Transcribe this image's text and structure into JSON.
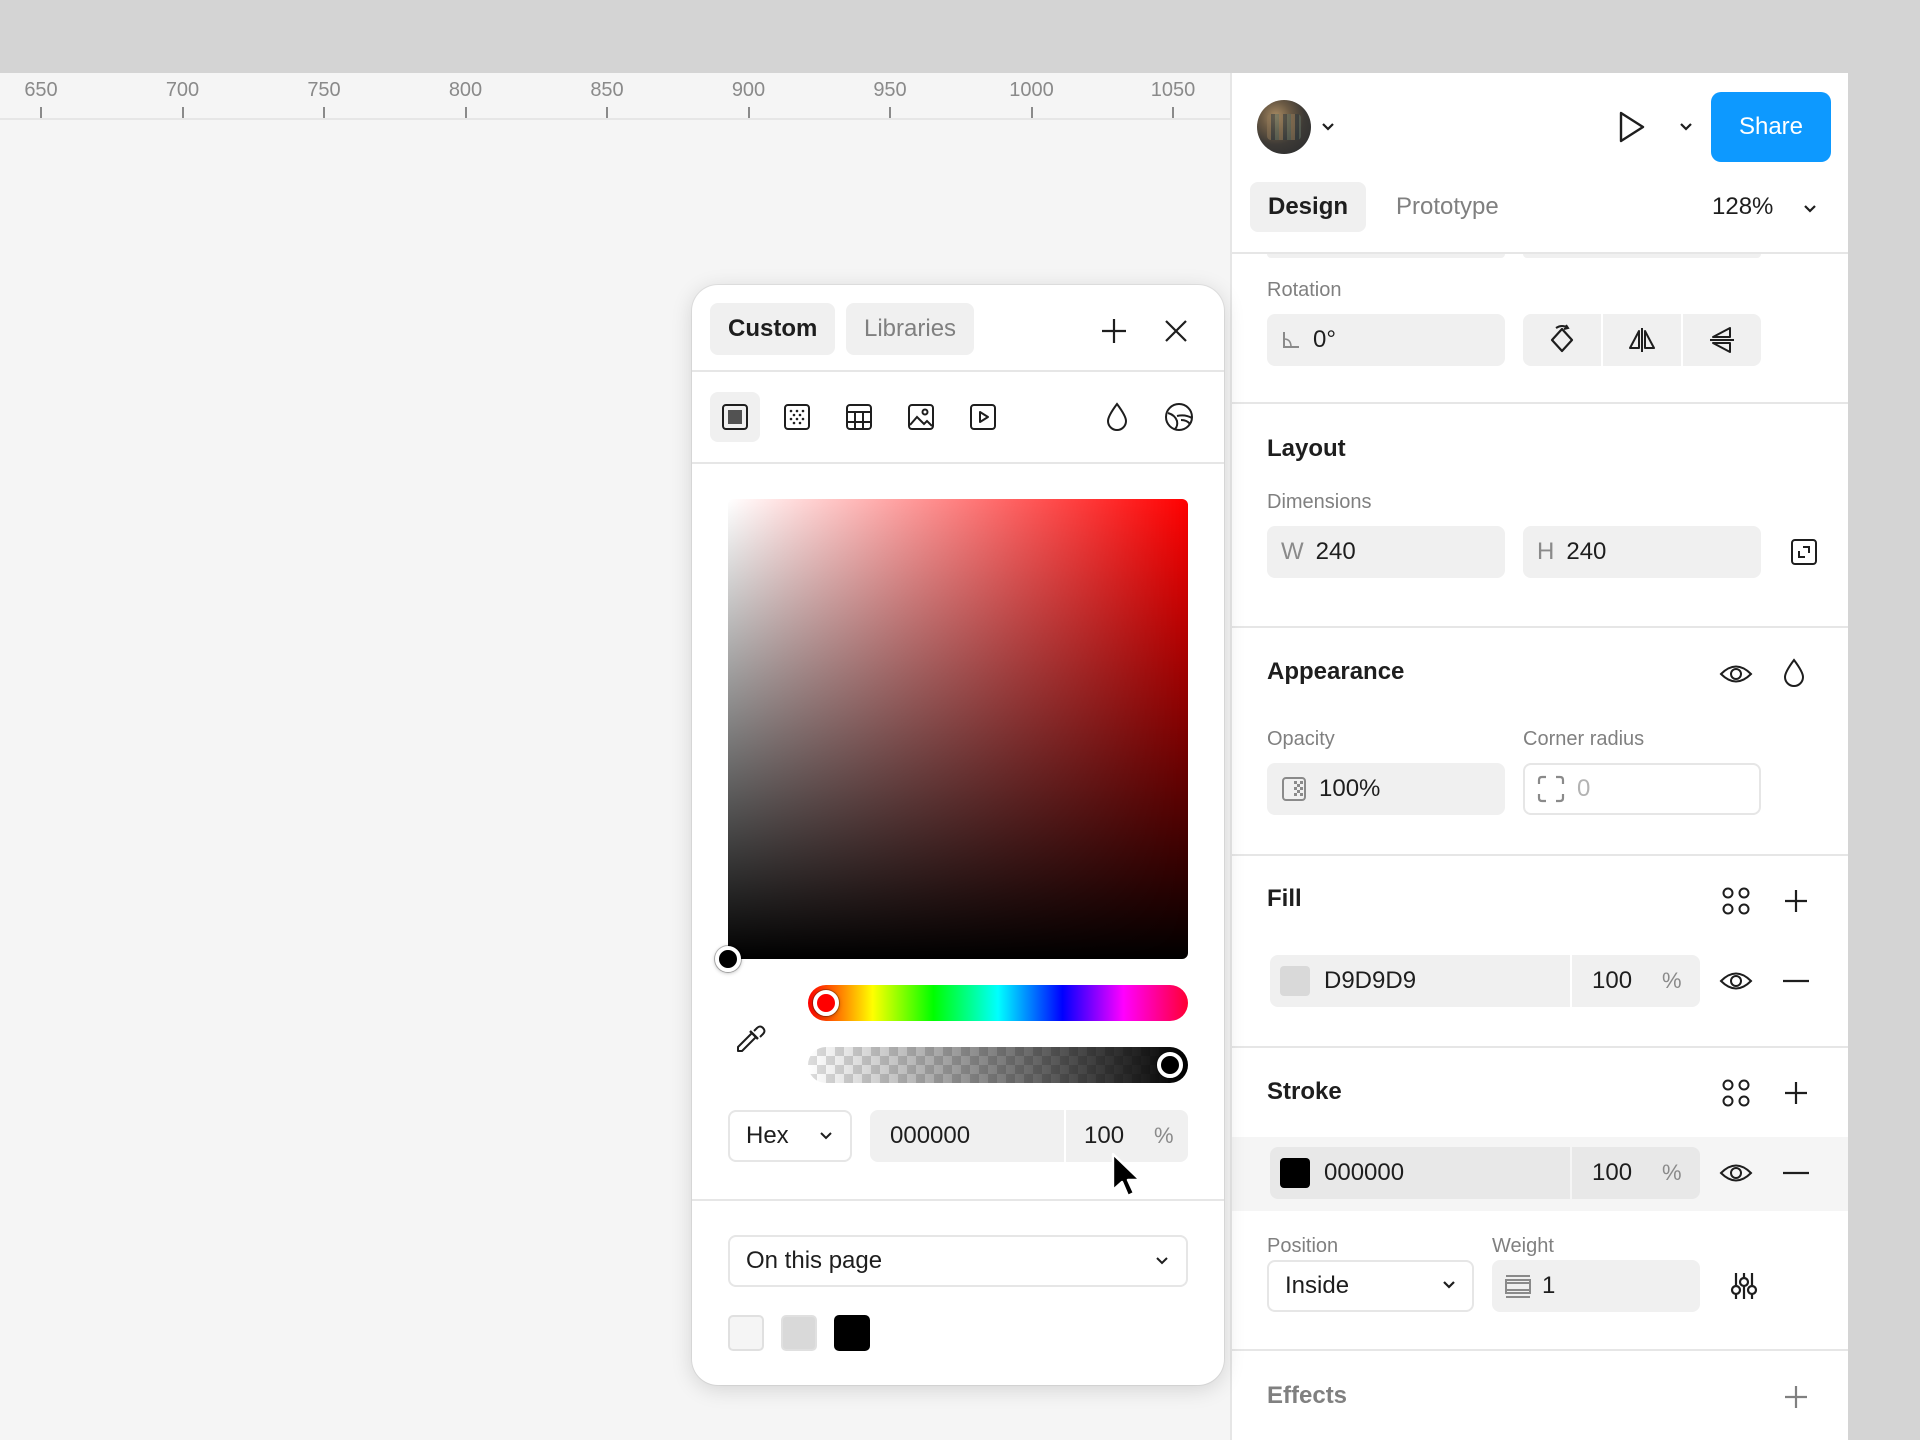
{
  "ruler": {
    "ticks": [
      "650",
      "700",
      "750",
      "800",
      "850",
      "900",
      "950",
      "1000",
      "1050"
    ]
  },
  "header": {
    "share_label": "Share",
    "tabs": [
      {
        "label": "Design",
        "active": true
      },
      {
        "label": "Prototype",
        "active": false
      }
    ],
    "zoom": "128%"
  },
  "rotation": {
    "label": "Rotation",
    "value": "0°"
  },
  "layout": {
    "title": "Layout",
    "dimensions_label": "Dimensions",
    "w_prefix": "W",
    "w_value": "240",
    "h_prefix": "H",
    "h_value": "240"
  },
  "appearance": {
    "title": "Appearance",
    "opacity_label": "Opacity",
    "opacity_value": "100%",
    "corner_label": "Corner radius",
    "corner_value": "0"
  },
  "fill": {
    "title": "Fill",
    "hex": "D9D9D9",
    "opacity": "100",
    "pct": "%",
    "color": "#d9d9d9"
  },
  "stroke": {
    "title": "Stroke",
    "hex": "000000",
    "opacity": "100",
    "pct": "%",
    "color": "#000000",
    "position_label": "Position",
    "position_value": "Inside",
    "weight_label": "Weight",
    "weight_value": "1"
  },
  "effects": {
    "title": "Effects"
  },
  "picker": {
    "tabs": [
      {
        "label": "Custom",
        "active": true
      },
      {
        "label": "Libraries",
        "active": false
      }
    ],
    "format": "Hex",
    "hex": "000000",
    "opacity": "100",
    "pct": "%",
    "hue_color": "#ff0000",
    "hue_position": 0,
    "alpha_position": 1,
    "scope": "On this page",
    "recent_colors": [
      "#f5f5f5",
      "#d9d9d9",
      "#000000"
    ]
  },
  "colors": {
    "accent": "#0d99ff"
  }
}
